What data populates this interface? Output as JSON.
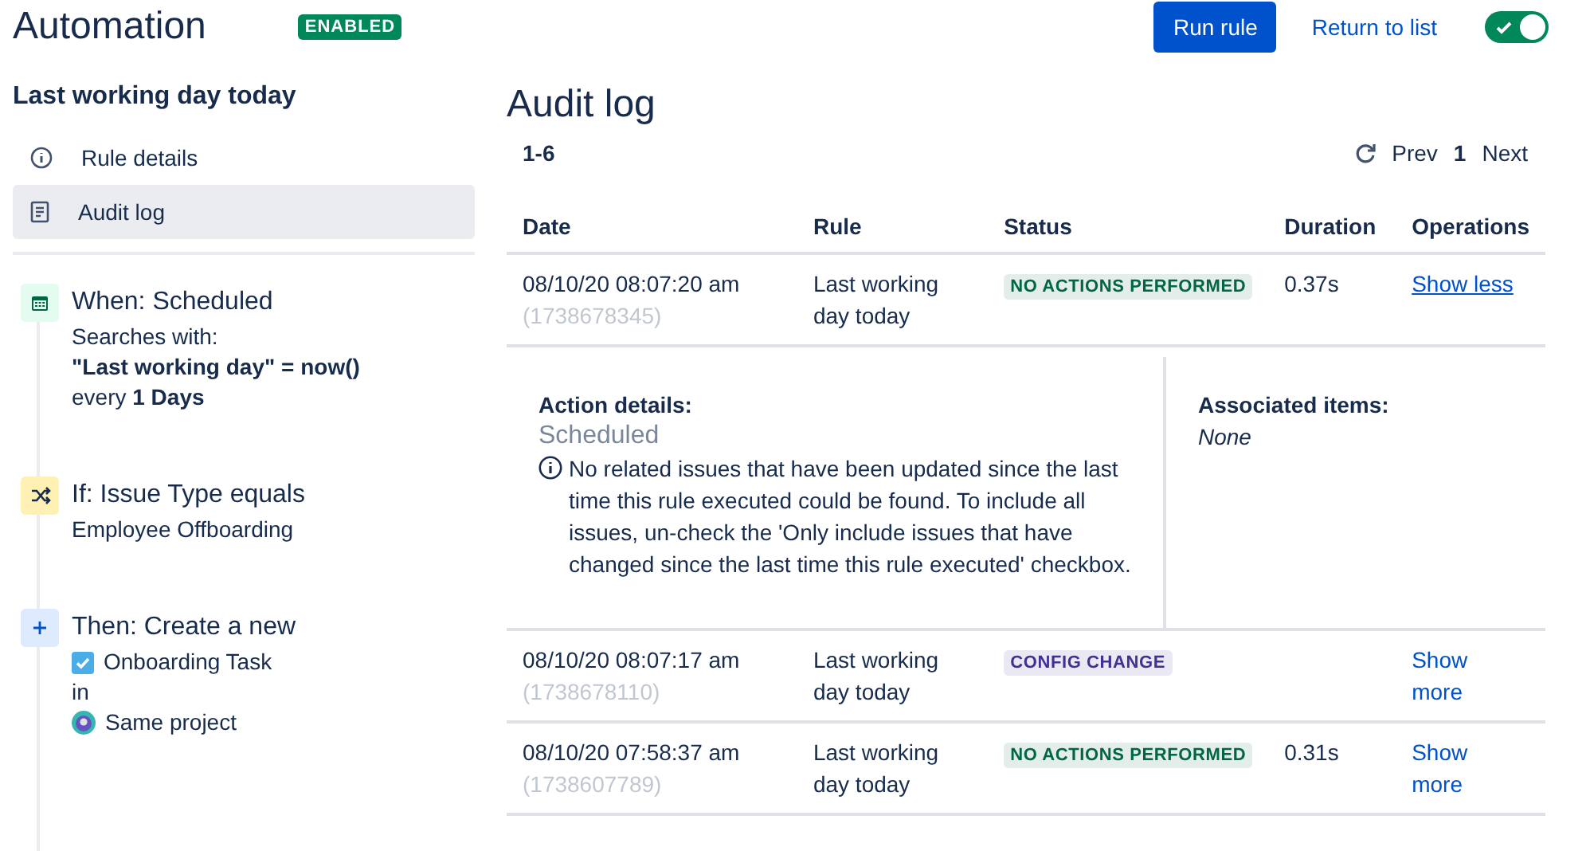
{
  "header": {
    "title": "Automation",
    "status_badge": "ENABLED",
    "run_button": "Run rule",
    "return_link": "Return to list",
    "toggle": {
      "on": true
    }
  },
  "sidebar": {
    "rule_name": "Last working day today",
    "nav": [
      {
        "label": "Rule details",
        "kind": "info",
        "selected": false
      },
      {
        "label": "Audit log",
        "kind": "log",
        "selected": true
      }
    ],
    "steps": [
      {
        "kind": "trigger",
        "title": "When: Scheduled",
        "lines": [
          {
            "kind": "text",
            "text": "Searches with:"
          },
          {
            "kind": "bold",
            "text": "\"Last working day\" = now()"
          },
          {
            "kind": "text",
            "text": "every **1 Days**"
          }
        ]
      },
      {
        "kind": "condition",
        "title": "If: Issue Type equals",
        "lines": [
          {
            "kind": "text",
            "text": "Employee Offboarding"
          }
        ]
      },
      {
        "kind": "action",
        "title": "Then: Create a new",
        "lines": [
          {
            "kind": "issue",
            "text": "Onboarding Task"
          },
          {
            "kind": "text",
            "text": "in"
          },
          {
            "kind": "project",
            "text": "Same project"
          }
        ]
      }
    ]
  },
  "audit_log": {
    "title": "Audit log",
    "range": "1-6",
    "pagination": {
      "prev": "Prev",
      "page": "1",
      "next": "Next"
    },
    "table": {
      "columns": [
        "Date",
        "Rule",
        "Status",
        "Duration",
        "Operations"
      ],
      "rows": [
        {
          "date": "08/10/20 08:07:20 am",
          "id": "(1738678345)",
          "rule": "Last working day today",
          "status": {
            "text": "NO ACTIONS PERFORMED",
            "color": "#006644"
          },
          "duration": "0.37s",
          "operation": "Show less",
          "expanded": true,
          "details": {
            "action_label": "Action details:",
            "action_name": "Scheduled",
            "message": "No related issues that have been updated since the last time this rule executed could be found. To include all issues, un-check the 'Only include issues that have changed since the last time this rule executed' checkbox.",
            "associated_label": "Associated items:",
            "associated_value": "None"
          }
        },
        {
          "date": "08/10/20 08:07:17 am",
          "id": "(1738678110)",
          "rule": "Last working day today",
          "status": {
            "text": "CONFIG CHANGE",
            "color": "#403294"
          },
          "operation": "Show more",
          "expanded": false
        },
        {
          "date": "08/10/20 07:58:37 am",
          "id": "(1738607789)",
          "rule": "Last working day today",
          "status": {
            "text": "NO ACTIONS PERFORMED",
            "color": "#006644"
          },
          "duration": "0.31s",
          "operation": "Show more",
          "expanded": false
        }
      ]
    }
  }
}
